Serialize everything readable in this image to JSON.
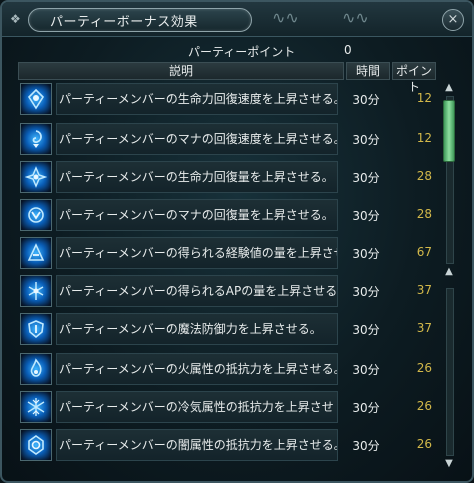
{
  "window": {
    "title": "パーティーボーナス効果",
    "close_symbol": "×"
  },
  "party_points": {
    "label": "パーティーポイント",
    "value": "0"
  },
  "columns": {
    "description": "説明",
    "time": "時間",
    "points": "ポイント"
  },
  "rows": [
    {
      "icon": "heart-regen-icon",
      "description": "パーティーメンバーの生命力回復速度を上昇させる。",
      "time": "30分",
      "points": "12"
    },
    {
      "icon": "mana-regen-icon",
      "description": "パーティーメンバーのマナの回復速度を上昇させる。",
      "time": "30分",
      "points": "12"
    },
    {
      "icon": "hp-boost-icon",
      "description": "パーティーメンバーの生命力回復量を上昇させる。",
      "time": "30分",
      "points": "28"
    },
    {
      "icon": "mp-boost-icon",
      "description": "パーティーメンバーのマナの回復量を上昇させる。",
      "time": "30分",
      "points": "28"
    },
    {
      "icon": "exp-boost-icon",
      "description": "パーティーメンバーの得られる経験値の量を上昇させ",
      "time": "30分",
      "points": "67"
    },
    {
      "icon": "ap-boost-icon",
      "description": "パーティーメンバーの得られるAPの量を上昇させる。",
      "time": "30分",
      "points": "37"
    },
    {
      "icon": "magic-defense-icon",
      "description": "パーティーメンバーの魔法防御力を上昇させる。",
      "time": "30分",
      "points": "37"
    },
    {
      "icon": "fire-resist-icon",
      "description": "パーティーメンバーの火属性の抵抗力を上昇させる。",
      "time": "30分",
      "points": "26"
    },
    {
      "icon": "ice-resist-icon",
      "description": "パーティーメンバーの冷気属性の抵抗力を上昇させ",
      "time": "30分",
      "points": "26"
    },
    {
      "icon": "dark-resist-icon",
      "description": "パーティーメンバーの闇属性の抵抗力を上昇させる。",
      "time": "30分",
      "points": "26"
    }
  ],
  "scrollbar": {
    "up_symbol": "▲",
    "down_symbol": "▼"
  }
}
